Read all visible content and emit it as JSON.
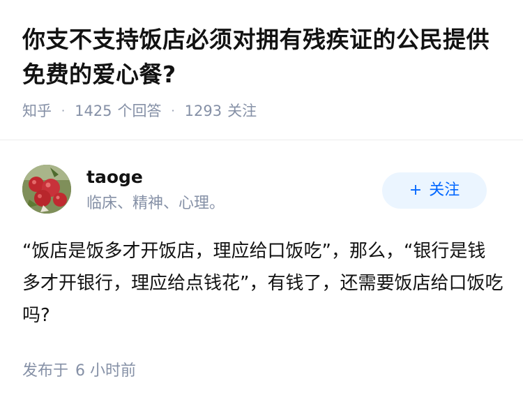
{
  "question": {
    "title": "你支不支持饭店必须对拥有残疾证的公民提供免费的爱心餐?",
    "source": "知乎",
    "answer_count": "1425",
    "answer_label": "个回答",
    "follower_count": "1293",
    "follower_label": "关注"
  },
  "author": {
    "name": "taoge",
    "bio": "临床、精神、心理。",
    "avatar_icon": "lychee-avatar",
    "follow_label": "关注"
  },
  "answer": {
    "content": "“饭店是饭多才开饭店，理应给口饭吃”，那么，“银行是钱多才开银行，理应给点钱花”，有钱了，还需要饭店给口饭吃吗?",
    "published_prefix": "发布于",
    "published_time": "6 小时前"
  },
  "colors": {
    "title": "#121212",
    "meta": "#8590a6",
    "follow_bg": "#ebf5ff",
    "follow_text": "#0066ff"
  }
}
